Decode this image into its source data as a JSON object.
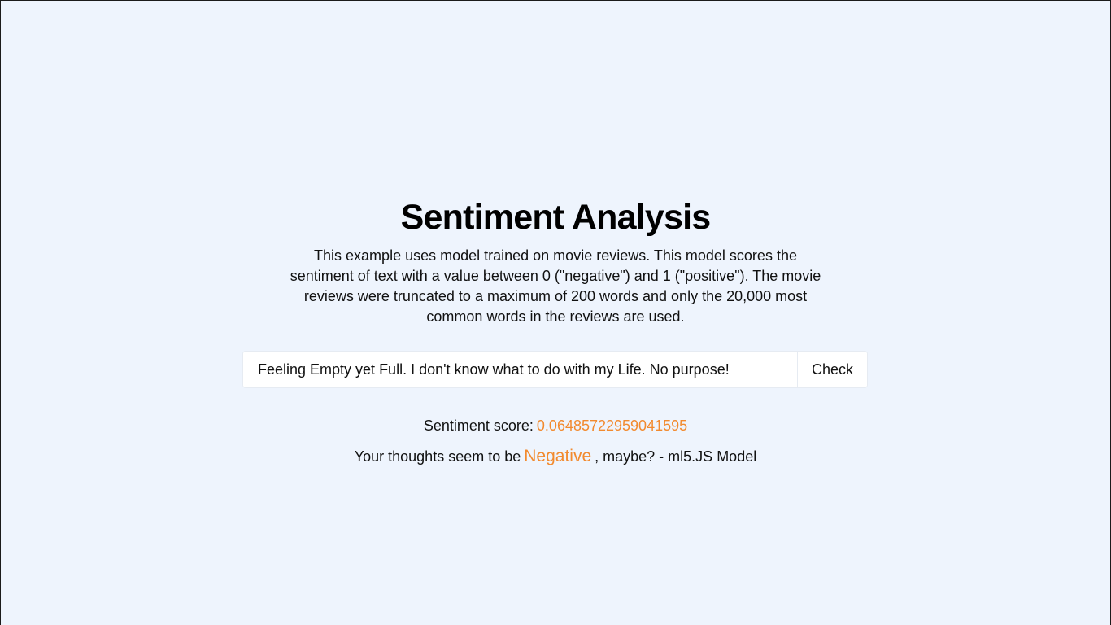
{
  "header": {
    "title": "Sentiment Analysis",
    "description": "This example uses model trained on movie reviews. This model scores the sentiment of text with a value between 0 (\"negative\") and 1 (\"positive\"). The movie reviews were truncated to a maximum of 200 words and only the 20,000 most common words in the reviews are used."
  },
  "form": {
    "input_value": "Feeling Empty yet Full. I don't know what to do with my Life. No purpose!",
    "button_label": "Check"
  },
  "result": {
    "score_label": "Sentiment score:",
    "score_value": "0.06485722959041595",
    "thoughts_prefix": "Your thoughts seem to be",
    "sentiment": "Negative",
    "thoughts_suffix": ", maybe? - ml5.JS Model"
  },
  "colors": {
    "background": "#eef4fd",
    "accent": "#f28a2e",
    "text": "#111111"
  }
}
